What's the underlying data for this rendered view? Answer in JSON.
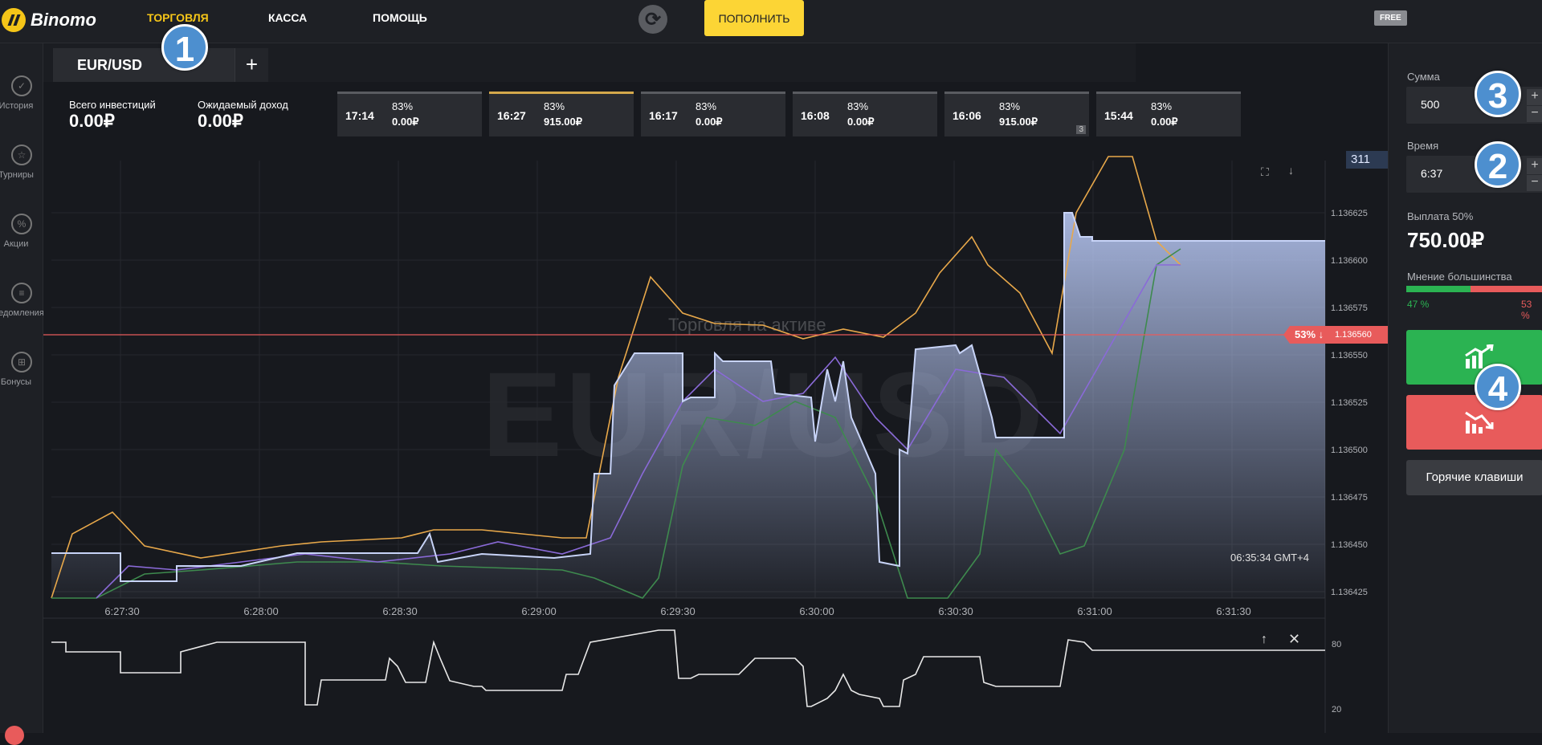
{
  "topbar": {
    "logo": "Binomo",
    "nav": [
      "ТОРГОВЛЯ",
      "КАССА",
      "ПОМОЩЬ"
    ],
    "deposit_label": "ПОПОЛНИТЬ",
    "free_badge": "FREE"
  },
  "sidebar": {
    "items": [
      {
        "label": "История",
        "icon": "check-icon"
      },
      {
        "label": "Турниры",
        "icon": "star-icon"
      },
      {
        "label": "Акции",
        "icon": "percent-icon"
      },
      {
        "label": "Уведомления",
        "icon": "menu-icon"
      },
      {
        "label": "Бонусы",
        "icon": "gift-icon"
      }
    ]
  },
  "tabs": {
    "active": "EUR/USD",
    "add": "+"
  },
  "annotations": [
    "1",
    "2",
    "3",
    "4"
  ],
  "info": {
    "total_label": "Всего инвестиций",
    "total_value": "0.00₽",
    "expected_label": "Ожидаемый доход",
    "expected_value": "0.00₽"
  },
  "deals": [
    {
      "time": "17:14",
      "pct": "83%",
      "amount": "0.00₽"
    },
    {
      "time": "16:27",
      "pct": "83%",
      "amount": "915.00₽"
    },
    {
      "time": "16:17",
      "pct": "83%",
      "amount": "0.00₽"
    },
    {
      "time": "16:08",
      "pct": "83%",
      "amount": "0.00₽"
    },
    {
      "time": "16:06",
      "pct": "83%",
      "amount": "915.00₽",
      "count": "3"
    },
    {
      "time": "15:44",
      "pct": "83%",
      "amount": "0.00₽"
    }
  ],
  "chart": {
    "watermark": "EUR/USD",
    "watermark_sub": "Торговля на активе",
    "current_price": "1.136560",
    "current_pct": "53% ↓",
    "tooltip": "311",
    "timestamp": "06:35:34 GMT+4",
    "y_ticks": [
      "1.136625",
      "1.136600",
      "1.136575",
      "1.136550",
      "1.136525",
      "1.136500",
      "1.136475",
      "1.136450",
      "1.136425"
    ],
    "x_ticks": [
      "6:27:30",
      "6:28:00",
      "6:28:30",
      "6:29:00",
      "6:29:30",
      "6:30:00",
      "6:30:30",
      "6:31:00",
      "6:31:30"
    ],
    "osc_ticks": [
      "80",
      "20"
    ]
  },
  "right": {
    "sum_label": "Сумма",
    "sum_value": "500",
    "time_label": "Время",
    "time_value": "6:37",
    "payout_label": "Выплата 50%",
    "payout_value": "750.00₽",
    "mood_label": "Мнение большинства",
    "mood_up": "47 %",
    "mood_down": "53 %",
    "hotkeys": "Горячие клавиши"
  },
  "colors": {
    "accent": "#f5c518",
    "up": "#2bb352",
    "down": "#e85b5b",
    "badge": "#4d8fcf"
  }
}
